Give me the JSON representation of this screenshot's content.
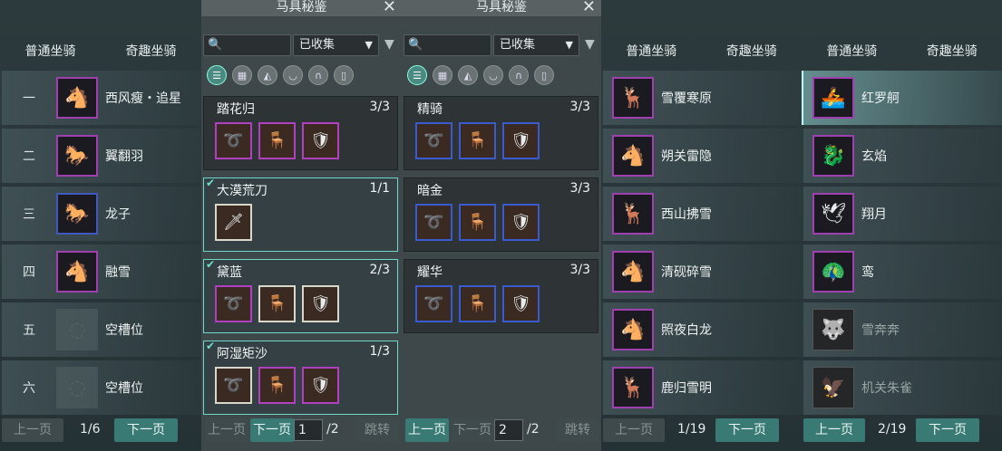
{
  "panel_left": {
    "tabs": [
      "普通坐骑",
      "奇趣坐骑"
    ],
    "rows": [
      {
        "index": "一",
        "name": "西风瘦・追星",
        "icon": "white-horse-icon"
      },
      {
        "index": "二",
        "name": "翼翻羽",
        "icon": "black-horse-icon"
      },
      {
        "index": "三",
        "name": "龙子",
        "icon": "dark-horse-icon"
      },
      {
        "index": "四",
        "name": "融雪",
        "icon": "white-horse-icon"
      },
      {
        "index": "五",
        "name": "空槽位",
        "icon": "empty-slot-icon"
      },
      {
        "index": "六",
        "name": "空槽位",
        "icon": "empty-slot-icon"
      }
    ],
    "pager": {
      "prev": "上一页",
      "page": "1/6",
      "next": "下一页"
    }
  },
  "panel_gear_a": {
    "title": "马具秘鉴",
    "close": "✕",
    "dropdown": "已收集",
    "sets": [
      {
        "name": "踏花归",
        "count": "3/3",
        "checked": false
      },
      {
        "name": "大漠荒刀",
        "count": "1/1",
        "checked": true
      },
      {
        "name": "黛蓝",
        "count": "2/3",
        "checked": true
      },
      {
        "name": "阿湿矩沙",
        "count": "1/3",
        "checked": true
      }
    ],
    "pager": {
      "prev": "上一页",
      "next": "下一页",
      "page_input": "1",
      "total": "/2",
      "jump": "跳转"
    }
  },
  "panel_gear_b": {
    "title": "马具秘鉴",
    "close": "✕",
    "dropdown": "已收集",
    "sets": [
      {
        "name": "精骑",
        "count": "3/3"
      },
      {
        "name": "暗金",
        "count": "3/3"
      },
      {
        "name": "耀华",
        "count": "3/3"
      }
    ],
    "pager": {
      "prev": "上一页",
      "next": "下一页",
      "page_input": "2",
      "total": "/2",
      "jump": "跳转"
    }
  },
  "panel_mounts_a": {
    "tabs": [
      "普通坐骑",
      "奇趣坐骑"
    ],
    "rows": [
      {
        "name": "雪覆寒原",
        "icon": "white-deer-icon"
      },
      {
        "name": "朔关雷隐",
        "icon": "white-horse-icon"
      },
      {
        "name": "西山拂雪",
        "icon": "white-deer-icon"
      },
      {
        "name": "清砚碎雪",
        "icon": "white-horse-icon"
      },
      {
        "name": "照夜白龙",
        "icon": "white-horse-icon"
      },
      {
        "name": "鹿归雪明",
        "icon": "deer-icon"
      }
    ],
    "pager": {
      "prev": "上一页",
      "page": "1/19",
      "next": "下一页"
    }
  },
  "panel_mounts_b": {
    "tabs": [
      "普通坐骑",
      "奇趣坐骑"
    ],
    "rows": [
      {
        "name": "红罗舸",
        "icon": "red-boat-icon"
      },
      {
        "name": "玄焰",
        "icon": "dark-beast-icon"
      },
      {
        "name": "翔月",
        "icon": "white-bird-icon"
      },
      {
        "name": "鸾",
        "icon": "golden-bird-icon"
      },
      {
        "name": "雪奔奔",
        "icon": "gray-beast-icon"
      },
      {
        "name": "机关朱雀",
        "icon": "mech-bird-icon"
      }
    ],
    "pager": {
      "prev": "上一页",
      "page": "2/19",
      "next": "下一页"
    }
  }
}
